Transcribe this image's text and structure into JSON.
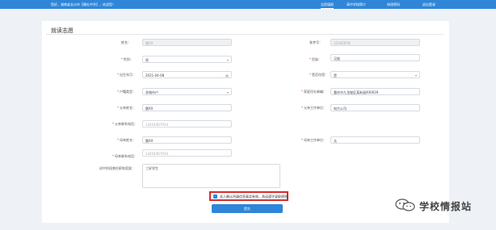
{
  "header": {
    "welcome": "您好，湖南省长沙市【雅礼中学】，欢迎您！",
    "nav": [
      "志愿填报",
      "高中学校简介",
      "修改密码",
      "退出登录"
    ]
  },
  "form": {
    "title": "就读志愿",
    "name_label": "姓名：",
    "name_value": "雷XX",
    "exam_label": "准考号：",
    "exam_value": "12345678",
    "gender_label": "性别：",
    "gender_value": "男",
    "ethnic_label": "民族：",
    "ethnic_value": "汉族",
    "birth_label": "出生年月：",
    "birth_value": "2021-04-08",
    "resident_label": "是否住宿：",
    "resident_value": "是",
    "status_label": "户籍类型：",
    "status_value": "非城市户",
    "address_label": "家庭住址邮编：",
    "address_value": "重庆市九龙坡区某街道400039",
    "father_label": "父亲姓名：",
    "father_value": "雷XX",
    "father_work_label": "父亲工作单位：",
    "father_work_value": "电力公司",
    "father_phone_label": "父亲联系电话：",
    "father_phone_placeholder": "13454467934",
    "mother_label": "母亲姓名：",
    "mother_value": "雷XX",
    "mother_work_label": "母亲工作单位：",
    "mother_work_value": "无",
    "mother_phone_label": "母亲联系电话：",
    "mother_phone_placeholder": "13454467934",
    "notes_label": "初中阶段曾任职和奖励：",
    "notes_value": "三好学生",
    "agree_text": "本人确认所填信息真实有效，承诺遵守录取规则",
    "submit_label": "提交"
  },
  "watermark": {
    "text": "学校情报站"
  },
  "colors": {
    "primary": "#2f86d8",
    "alert": "#d92b2b"
  }
}
